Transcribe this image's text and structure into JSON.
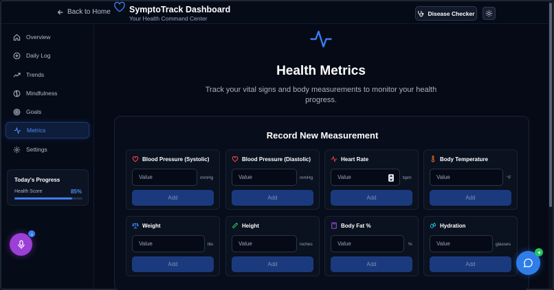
{
  "header": {
    "back_label": "Back to Home",
    "title": "SymptoTrack Dashboard",
    "subtitle": "Your Health Command Center",
    "disease_checker_label": "Disease Checker"
  },
  "sidebar": {
    "items": [
      {
        "label": "Overview",
        "icon": "home-icon"
      },
      {
        "label": "Daily Log",
        "icon": "plus-circle-icon"
      },
      {
        "label": "Trends",
        "icon": "trending-up-icon"
      },
      {
        "label": "Mindfulness",
        "icon": "brain-icon"
      },
      {
        "label": "Goals",
        "icon": "target-icon"
      },
      {
        "label": "Metrics",
        "icon": "activity-icon",
        "active": true
      },
      {
        "label": "Settings",
        "icon": "gear-icon"
      }
    ],
    "progress": {
      "title": "Today's Progress",
      "label": "Health Score",
      "value": "85%",
      "fraction": 0.85
    }
  },
  "main": {
    "title": "Health Metrics",
    "subtitle": "Track your vital signs and body measurements to monitor your health progress.",
    "record_title": "Record New Measurement",
    "metrics": [
      {
        "label": "Blood Pressure (Systolic)",
        "placeholder": "Value",
        "unit": "mmHg",
        "button": "Add",
        "icon": "heart-icon"
      },
      {
        "label": "Blood Pressure (Diastolic)",
        "placeholder": "Value",
        "unit": "mmHg",
        "button": "Add",
        "icon": "heart-icon"
      },
      {
        "label": "Heart Rate",
        "placeholder": "Value",
        "unit": "bpm",
        "button": "Add",
        "icon": "activity-icon"
      },
      {
        "label": "Body Temperature",
        "placeholder": "Value",
        "unit": "°F",
        "button": "Add",
        "icon": "thermometer-icon"
      },
      {
        "label": "Weight",
        "placeholder": "Value",
        "unit": "lbs",
        "button": "Add",
        "icon": "scale-icon"
      },
      {
        "label": "Height",
        "placeholder": "Value",
        "unit": "inches",
        "button": "Add",
        "icon": "ruler-icon"
      },
      {
        "label": "Body Fat %",
        "placeholder": "Value",
        "unit": "%",
        "button": "Add",
        "icon": "calculator-icon"
      },
      {
        "label": "Hydration",
        "placeholder": "Value",
        "unit": "glasses",
        "button": "Add",
        "icon": "droplets-icon"
      }
    ]
  },
  "colors": {
    "accent": "#3b7ef0",
    "background": "#050a16",
    "mic": "#9b3fd6",
    "chat": "#2f7de8",
    "badge_green": "#22c55e"
  }
}
